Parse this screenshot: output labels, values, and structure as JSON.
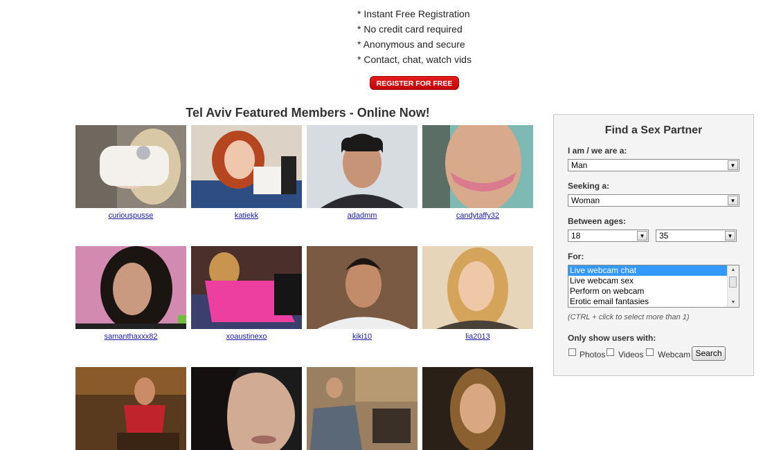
{
  "benefits": [
    "* Instant Free Registration",
    "* No credit card required",
    "* Anonymous and secure",
    "* Contact, chat, watch vids"
  ],
  "register_button": "REGISTER FOR FREE",
  "featured_title": "Tel Aviv Featured Members - Online Now!",
  "members": [
    {
      "username": "curiouspusse"
    },
    {
      "username": "katiekk"
    },
    {
      "username": "adadmm"
    },
    {
      "username": "candytaffy32"
    },
    {
      "username": "samanthaxxx82"
    },
    {
      "username": "xoaustinexo"
    },
    {
      "username": "kiki10"
    },
    {
      "username": "lia2013"
    },
    {
      "username": ""
    },
    {
      "username": ""
    },
    {
      "username": ""
    },
    {
      "username": ""
    }
  ],
  "search_panel": {
    "title": "Find a Sex Partner",
    "iam_label": "I am / we are a:",
    "iam_value": "Man",
    "seeking_label": "Seeking a:",
    "seeking_value": "Woman",
    "ages_label": "Between ages:",
    "age_min": "18",
    "age_max": "35",
    "for_label": "For:",
    "for_options": [
      "Live webcam chat",
      "Live webcam sex",
      "Perform on webcam",
      "Erotic email fantasies"
    ],
    "hint": "(CTRL + click to select more than 1)",
    "only_show_label": "Only show users with:",
    "photos_label": "Photos",
    "videos_label": "Videos",
    "webcam_label": "Webcam",
    "search_button": "Search"
  }
}
